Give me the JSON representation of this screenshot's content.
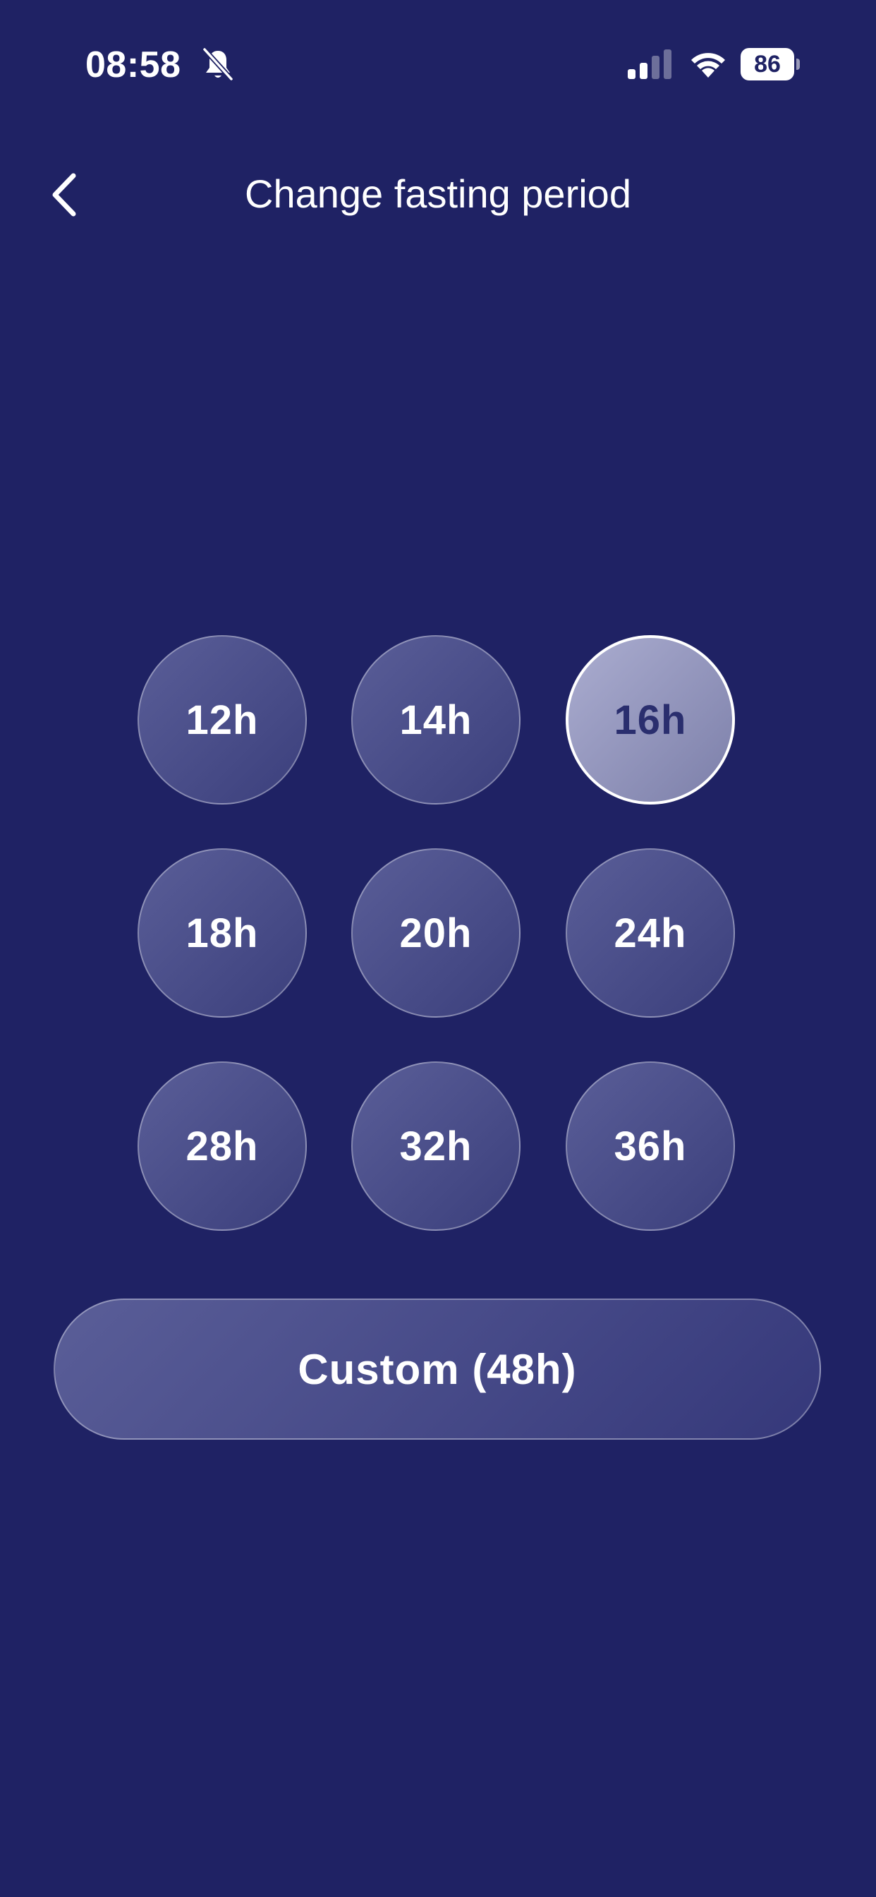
{
  "status_bar": {
    "time": "08:58",
    "battery_level": "86",
    "icons": [
      "bell-muted-icon",
      "cellular-signal-icon",
      "wifi-icon",
      "battery-icon"
    ]
  },
  "header": {
    "title": "Change fasting period",
    "back_icon": "chevron-left-icon"
  },
  "periods": [
    {
      "label": "12h",
      "selected": false
    },
    {
      "label": "14h",
      "selected": false
    },
    {
      "label": "16h",
      "selected": true
    },
    {
      "label": "18h",
      "selected": false
    },
    {
      "label": "20h",
      "selected": false
    },
    {
      "label": "24h",
      "selected": false
    },
    {
      "label": "28h",
      "selected": false
    },
    {
      "label": "32h",
      "selected": false
    },
    {
      "label": "36h",
      "selected": false
    }
  ],
  "custom_button": {
    "label": "Custom (48h)"
  },
  "colors": {
    "background": "#1f2264",
    "selected_fill": "#a3a5cb",
    "option_fill": "#4a4e8a",
    "text": "#ffffff"
  }
}
